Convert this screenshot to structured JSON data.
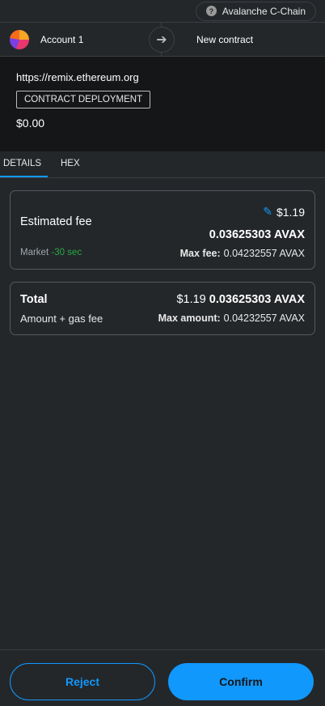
{
  "network": {
    "name": "Avalanche C-Chain",
    "icon": "help-icon"
  },
  "header": {
    "from_account": "Account 1",
    "arrow_icon": "arrow-right-icon",
    "to_label": "New contract"
  },
  "origin": {
    "url": "https://remix.ethereum.org",
    "tx_type": "CONTRACT DEPLOYMENT",
    "value": "$0.00"
  },
  "tabs": [
    {
      "label": "DETAILS",
      "active": true
    },
    {
      "label": "HEX",
      "active": false
    }
  ],
  "fee": {
    "label": "Estimated fee",
    "fiat": "$1.19",
    "native": "0.03625303 AVAX",
    "market_label": "Market",
    "market_time": "-30 sec",
    "max_fee_label": "Max fee:",
    "max_fee_value": "0.04232557 AVAX"
  },
  "total": {
    "label": "Total",
    "fiat": "$1.19",
    "native": "0.03625303 AVAX",
    "sub_label": "Amount + gas fee",
    "max_amount_label": "Max amount:",
    "max_amount_value": "0.04232557 AVAX"
  },
  "footer": {
    "reject_label": "Reject",
    "confirm_label": "Confirm"
  },
  "colors": {
    "accent": "#1098fc",
    "market_green": "#28a745",
    "background": "#24272a"
  }
}
